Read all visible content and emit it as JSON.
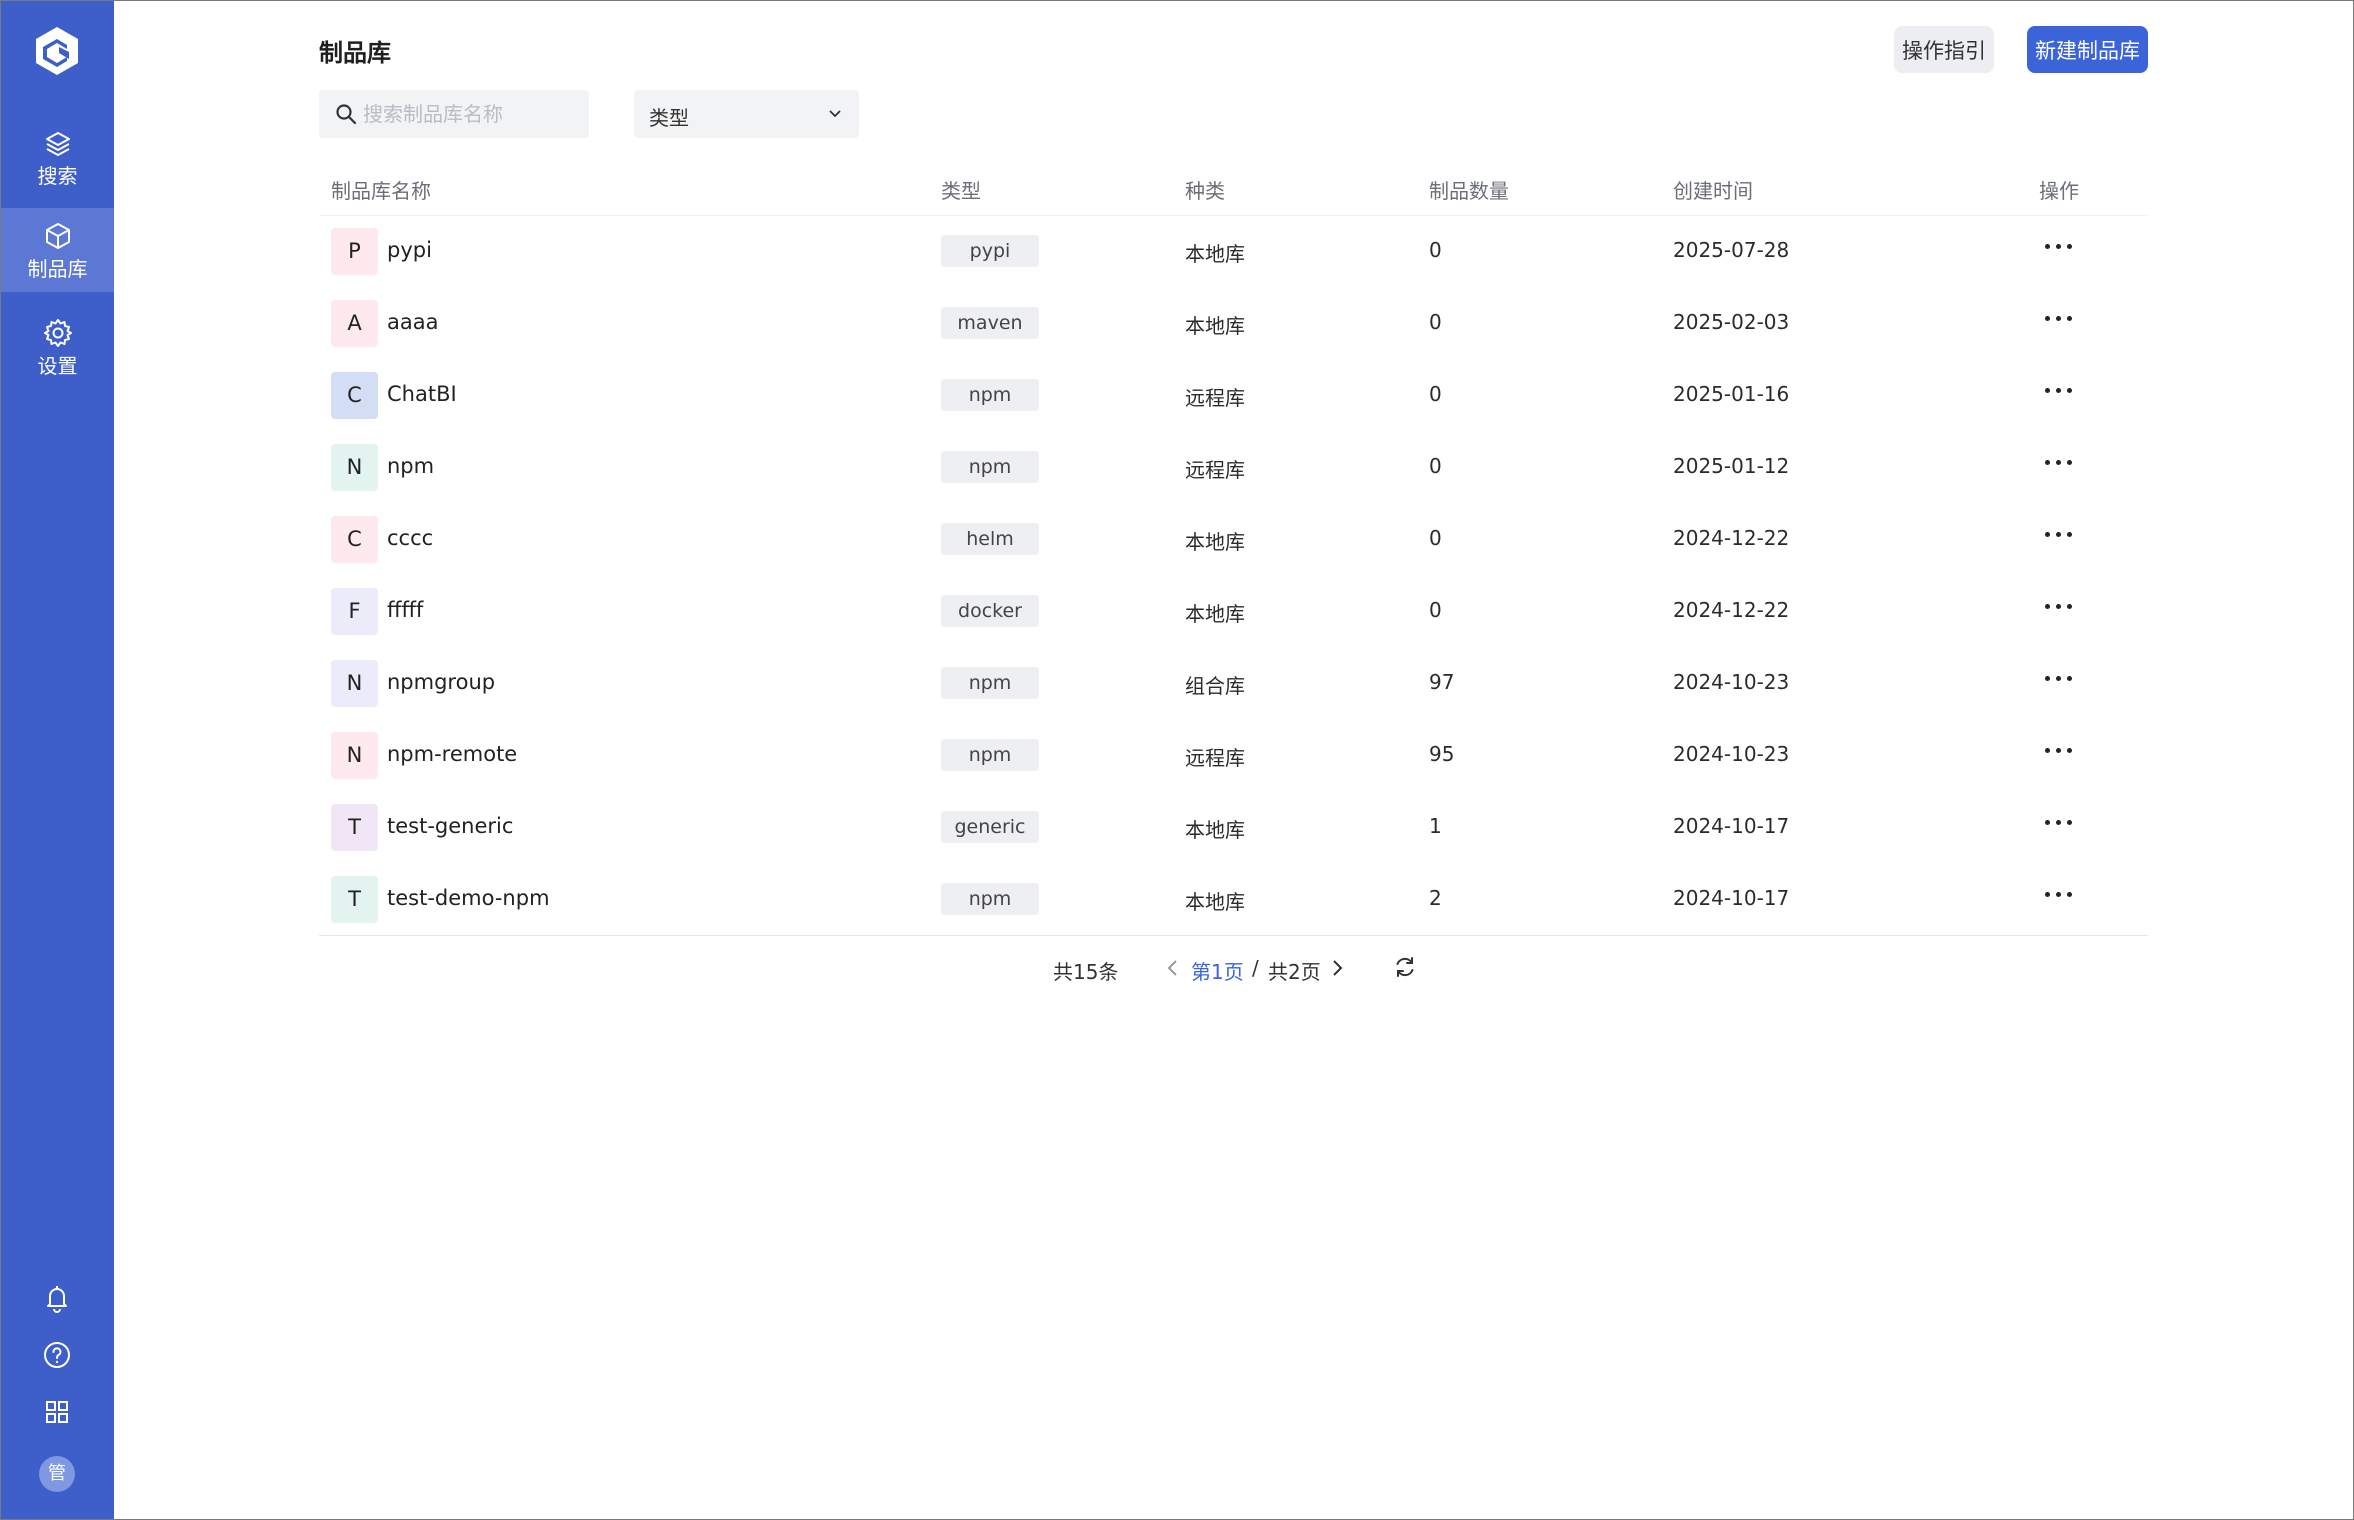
{
  "sidebar": {
    "items": [
      {
        "label": "搜索",
        "icon": "layers-icon",
        "active": false
      },
      {
        "label": "制品库",
        "icon": "cube-icon",
        "active": true
      },
      {
        "label": "设置",
        "icon": "gear-icon",
        "active": false
      }
    ],
    "bottom_icons": [
      "bell-icon",
      "help-icon",
      "apps-grid-icon"
    ],
    "avatar_text": "管"
  },
  "header": {
    "title": "制品库",
    "guide_label": "操作指引",
    "new_label": "新建制品库"
  },
  "filters": {
    "search_placeholder": "搜索制品库名称",
    "search_value": "",
    "type_select_value": "类型"
  },
  "table": {
    "columns": [
      "制品库名称",
      "类型",
      "种类",
      "制品数量",
      "创建时间",
      "操作"
    ],
    "rows": [
      {
        "letter": "P",
        "letter_bg": "#fde9ee",
        "name": "pypi",
        "type": "pypi",
        "kind": "本地库",
        "count": "0",
        "created": "2025-07-28"
      },
      {
        "letter": "A",
        "letter_bg": "#fde9ee",
        "name": "aaaa",
        "type": "maven",
        "kind": "本地库",
        "count": "0",
        "created": "2025-02-03"
      },
      {
        "letter": "C",
        "letter_bg": "#d3ddf3",
        "name": "ChatBI",
        "type": "npm",
        "kind": "远程库",
        "count": "0",
        "created": "2025-01-16"
      },
      {
        "letter": "N",
        "letter_bg": "#e3f3f0",
        "name": "npm",
        "type": "npm",
        "kind": "远程库",
        "count": "0",
        "created": "2025-01-12"
      },
      {
        "letter": "C",
        "letter_bg": "#fde9ee",
        "name": "cccc",
        "type": "helm",
        "kind": "本地库",
        "count": "0",
        "created": "2024-12-22"
      },
      {
        "letter": "F",
        "letter_bg": "#ebebfa",
        "name": "fffff",
        "type": "docker",
        "kind": "本地库",
        "count": "0",
        "created": "2024-12-22"
      },
      {
        "letter": "N",
        "letter_bg": "#ebebfa",
        "name": "npmgroup",
        "type": "npm",
        "kind": "组合库",
        "count": "97",
        "created": "2024-10-23"
      },
      {
        "letter": "N",
        "letter_bg": "#fde9ee",
        "name": "npm-remote",
        "type": "npm",
        "kind": "远程库",
        "count": "95",
        "created": "2024-10-23"
      },
      {
        "letter": "T",
        "letter_bg": "#f1e6f6",
        "name": "test-generic",
        "type": "generic",
        "kind": "本地库",
        "count": "1",
        "created": "2024-10-17"
      },
      {
        "letter": "T",
        "letter_bg": "#e3f3f0",
        "name": "test-demo-npm",
        "type": "npm",
        "kind": "本地库",
        "count": "2",
        "created": "2024-10-17"
      }
    ]
  },
  "pagination": {
    "total": "共15条",
    "current": "第1页",
    "separator": "/",
    "pages": "共2页"
  },
  "colors": {
    "sidebar_bg": "#3e5ec9",
    "sidebar_active": "#5c78d4",
    "primary": "#3a64d8"
  }
}
